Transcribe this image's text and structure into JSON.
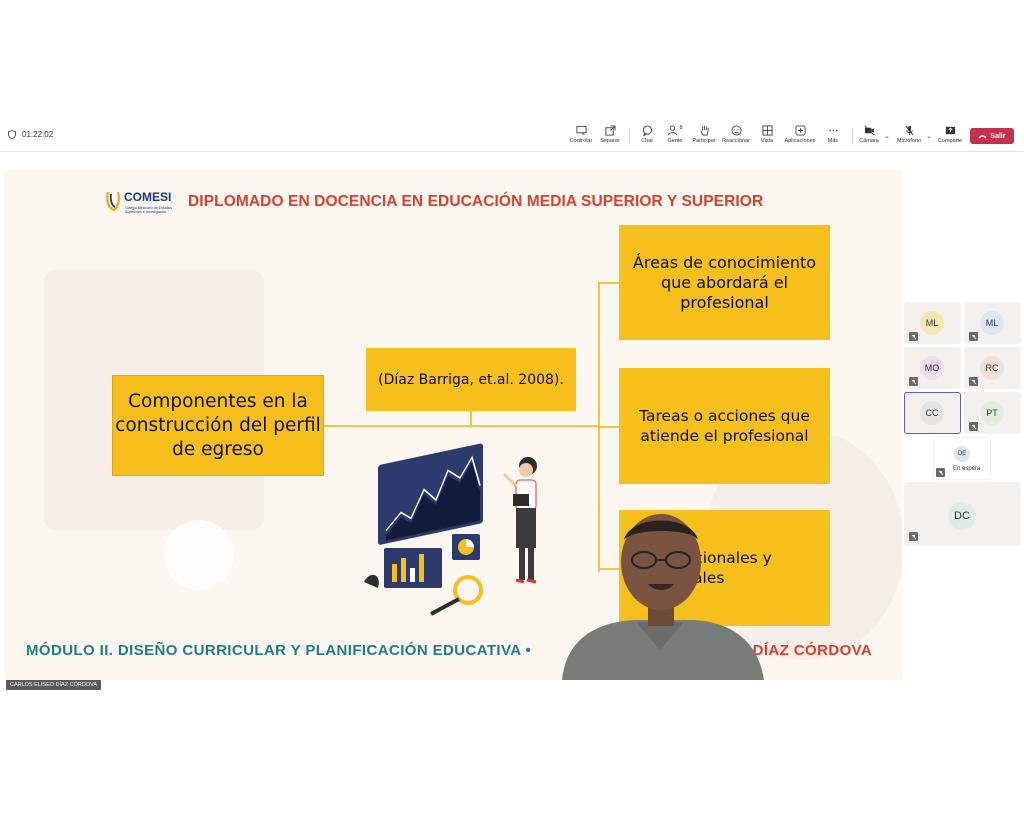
{
  "toolbar": {
    "timer": "01:22:02",
    "buttons": {
      "control": "Controlar",
      "separate": "Separar",
      "chat": "Chat",
      "people": "Gente",
      "people_count": "8",
      "raise": "Participar",
      "react": "Reaccionar",
      "view": "Vista",
      "apps": "Aplicaciones",
      "more": "Más",
      "camera": "Cámara",
      "mic": "Micrófono",
      "share": "Comparte"
    },
    "leave": "Salir"
  },
  "slide": {
    "logo_text": "COMESI",
    "logo_sub": "Colegio Mexicano de Estudios Superiores e Investigación",
    "title": "DIPLOMADO EN DOCENCIA EN EDUCACIÓN MEDIA SUPERIOR Y SUPERIOR",
    "main_box": "Componentes en la construcción del perfil de egreso",
    "citation": "(Díaz Barriga, et.al. 2008).",
    "box_a": "Áreas de conocimiento que abordará el profesional",
    "box_b": "Tareas o acciones que atiende el profesional",
    "box_c": "Niveles ocupacionales y funcionales",
    "box_c_visible": "Ni          cionales y\n           nales",
    "footer_left": "MÓDULO II. DISEÑO CURRICULAR Y PLANIFICACIÓN EDUCATIVA •",
    "footer_right": "O DÍAZ CÓRDOVA"
  },
  "presenter_name": "CARLOS ELISEO DÍAZ CÓRDOVA",
  "participants": [
    {
      "initials": "ML",
      "color": "#f5e6b8"
    },
    {
      "initials": "ML",
      "color": "#dde6f2"
    },
    {
      "initials": "MO",
      "color": "#f2dcea"
    },
    {
      "initials": "RC",
      "color": "#f0e0dc"
    },
    {
      "initials": "CC",
      "color": "#e4e4e4"
    },
    {
      "initials": "PT",
      "color": "#e0eee0"
    },
    {
      "initials": "DC",
      "color": "#dfece6"
    }
  ],
  "waiting": {
    "initials": "DE",
    "label": "En espera"
  },
  "colors": {
    "accent": "#f6bf1b",
    "title_red": "#d9402f",
    "footer_teal": "#1f7d84",
    "leave_red": "#c4314b",
    "selected": "#5b5fc7"
  }
}
